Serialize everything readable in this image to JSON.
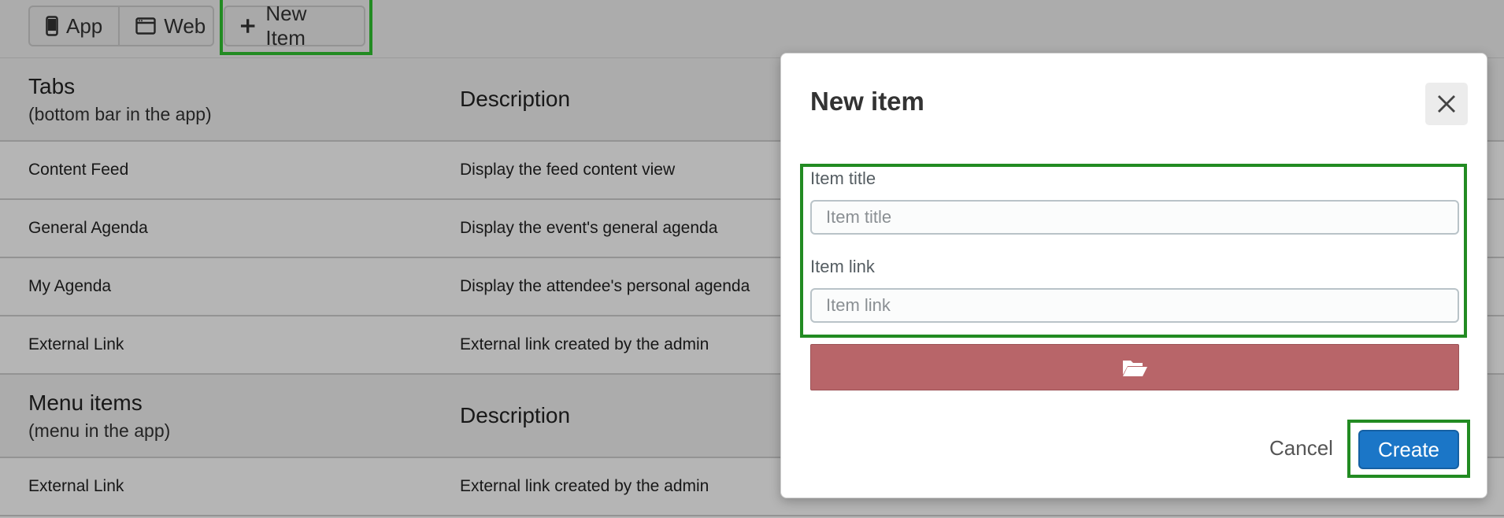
{
  "toolbar": {
    "app_label": "App",
    "web_label": "Web",
    "new_item_label": "New Item"
  },
  "tabs_section": {
    "title": "Tabs",
    "subtitle": "(bottom bar in the app)",
    "description_header": "Description",
    "rows": [
      {
        "name": "Content Feed",
        "description": "Display the feed content view"
      },
      {
        "name": "General Agenda",
        "description": "Display the event's general agenda"
      },
      {
        "name": "My Agenda",
        "description": "Display the attendee's personal agenda"
      },
      {
        "name": "External Link",
        "description": "External link created by the admin"
      }
    ]
  },
  "menu_section": {
    "title": "Menu items",
    "subtitle": "(menu in the app)",
    "description_header": "Description",
    "rows": [
      {
        "name": "External Link",
        "description": "External link created by the admin"
      }
    ]
  },
  "modal": {
    "title": "New item",
    "item_title_label": "Item title",
    "item_title_placeholder": "Item title",
    "item_title_value": "",
    "item_link_label": "Item link",
    "item_link_placeholder": "Item link",
    "item_link_value": "",
    "upload_icon": "folder-open-icon",
    "cancel_label": "Cancel",
    "create_label": "Create"
  },
  "colors": {
    "highlight": "#228b22",
    "create_button": "#1b76c7",
    "upload_button": "#b86569"
  }
}
